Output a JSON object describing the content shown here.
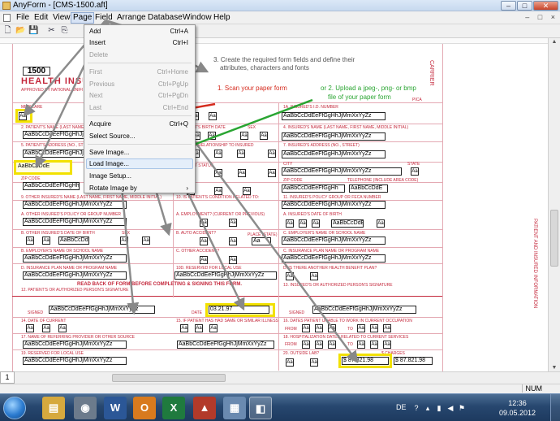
{
  "window": {
    "title": "AnyForm - [CMS-1500.aft]",
    "controls": {
      "minimize": "–",
      "maximize": "□",
      "close": "✕"
    }
  },
  "menubar": {
    "items": [
      "File",
      "Edit",
      "View",
      "Page",
      "Field",
      "Arrange",
      "Database",
      "Window",
      "Help"
    ],
    "active": "Page",
    "mdi_controls": "– □ ×"
  },
  "page_menu": {
    "items": [
      {
        "label": "Add",
        "shortcut": "Ctrl+A",
        "enabled": true
      },
      {
        "label": "Insert",
        "shortcut": "Ctrl+I",
        "enabled": true
      },
      {
        "label": "Delete",
        "shortcut": "",
        "enabled": false
      },
      {
        "label": "First",
        "shortcut": "Ctrl+Home",
        "enabled": false
      },
      {
        "label": "Previous",
        "shortcut": "Ctrl+PgUp",
        "enabled": false
      },
      {
        "label": "Next",
        "shortcut": "Ctrl+PgDn",
        "enabled": false
      },
      {
        "label": "Last",
        "shortcut": "Ctrl+End",
        "enabled": false
      },
      {
        "label": "Acquire",
        "shortcut": "Ctrl+Q",
        "enabled": true
      },
      {
        "label": "Select Source...",
        "shortcut": "",
        "enabled": true
      },
      {
        "label": "Save Image...",
        "shortcut": "",
        "enabled": true
      },
      {
        "label": "Load Image...",
        "shortcut": "",
        "enabled": true
      },
      {
        "label": "Image Setup...",
        "shortcut": "",
        "enabled": true
      },
      {
        "label": "Rotate Image by",
        "shortcut": "›",
        "enabled": true
      }
    ]
  },
  "annotations": {
    "step1": "1.  Scan your paper form",
    "step2_line1": "or 2. Upload a jpeg-, png- or bmp",
    "step2_line2": "file of your paper form",
    "step3_line1": "3. Create the required form fields and define their",
    "step3_line2": "attributes, characters and fonts"
  },
  "form": {
    "number": "1500",
    "heading": "HEALTH INSURANCE CLAIM FORM",
    "approved": "APPROVED BY NATIONAL UNIFORM CLAIM COMMITTEE 08/05",
    "carrier": "CARRIER",
    "side_label": "PATIENT AND INSURED INFORMATION",
    "sample_text": "AaBbCcDdEeFfGgHhJjMmXxYyZz",
    "sample_short": "AaBbCcDdEeFfGgHh",
    "sample_small": "AaBbCcDdE",
    "aa": "Aa",
    "date_value": "03.21.97",
    "amount": "$ 87.821.98",
    "labels": {
      "medicare": "MEDICARE",
      "pica": "PICA",
      "insured_id": "1a. INSURED'S I.D. NUMBER",
      "patient_name": "2. PATIENT'S NAME (Last Name, First Name, Middle Initial)",
      "birth": "3. PATIENT'S BIRTH DATE",
      "sex": "SEX",
      "insured_name": "4. INSURED'S NAME (Last Name, First Name, Middle Initial)",
      "patient_address": "5. PATIENT'S ADDRESS (No., Street)",
      "relationship": "6. PATIENT RELATIONSHIP TO INSURED",
      "insured_address": "7. INSURED'S ADDRESS (No., Street)",
      "city": "CITY",
      "state": "STATE",
      "status": "8. PATIENT STATUS",
      "zip": "ZIP CODE",
      "telephone": "TELEPHONE (Include Area Code)",
      "other_insured": "9. OTHER INSURED'S NAME (Last Name, First Name, Middle Initial)",
      "condition": "10. IS PATIENT'S CONDITION RELATED TO:",
      "policy": "11. INSURED'S POLICY GROUP OR FECA NUMBER",
      "other_policy": "a. OTHER INSURED'S POLICY OR GROUP NUMBER",
      "employment": "a. EMPLOYMENT? (Current or Previous)",
      "insured_birth": "a. INSURED'S DATE OF BIRTH",
      "other_birth": "b. OTHER INSURED'S DATE OF BIRTH",
      "auto": "b. AUTO ACCIDENT?",
      "place": "PLACE (State)",
      "employer_other": "b. EMPLOYER'S NAME OR SCHOOL NAME",
      "employer_insured": "c. EMPLOYER'S NAME OR SCHOOL NAME",
      "other_accident": "c. OTHER ACCIDENT?",
      "insurance_plan": "c. INSURANCE PLAN NAME OR PROGRAM NAME",
      "plan_other": "d. INSURANCE PLAN NAME OR PROGRAM NAME",
      "reserved_local": "10d. RESERVED FOR LOCAL USE",
      "another_plan": "d. IS THERE ANOTHER HEALTH BENEFIT PLAN?",
      "read_back": "READ BACK OF FORM BEFORE COMPLETING & SIGNING THIS FORM.",
      "signature12": "12. PATIENT'S OR AUTHORIZED PERSON'S SIGNATURE",
      "signature13": "13. INSURED'S OR AUTHORIZED PERSON'S SIGNATURE",
      "signed": "SIGNED",
      "date": "DATE",
      "date_current": "14. DATE OF CURRENT",
      "same_illness": "15. IF PATIENT HAS HAD SAME OR SIMILAR ILLNESS",
      "unable_work": "16. DATES PATIENT UNABLE TO WORK IN CURRENT OCCUPATION",
      "referring": "17. NAME OF REFERRING PROVIDER OR OTHER SOURCE",
      "hospitalization": "18. HOSPITALIZATION DATES RELATED TO CURRENT SERVICES",
      "reserved19": "19. RESERVED FOR LOCAL USE",
      "outside_lab": "20. OUTSIDE LAB?",
      "charges": "$ CHARGES",
      "from": "FROM",
      "to": "TO",
      "yes": "YES",
      "no": "NO",
      "self": "Self",
      "spouse": "Spouse",
      "child": "Child",
      "other": "Other",
      "single": "Single",
      "married": "Married",
      "employed": "Employed",
      "fulltime": "Full-Time Student",
      "parttime": "Part-Time Student"
    }
  },
  "statusbar": {
    "num": "NUM"
  },
  "page_tab": "1",
  "taskbar": {
    "apps": [
      "W",
      "X",
      "O"
    ],
    "language": "DE",
    "time": "12:36",
    "date": "09.05.2012"
  }
}
